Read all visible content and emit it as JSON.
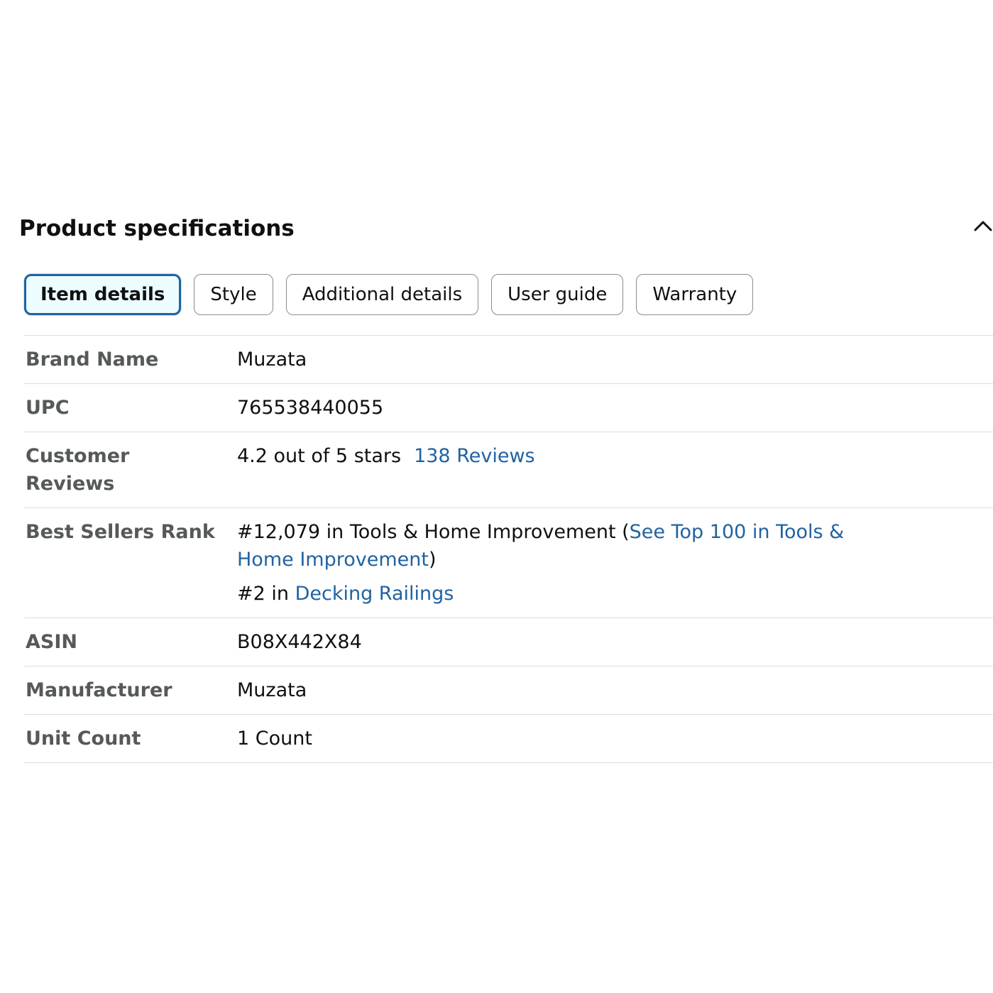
{
  "section": {
    "title": "Product specifications"
  },
  "tabs": [
    {
      "label": "Item details",
      "active": true
    },
    {
      "label": "Style",
      "active": false
    },
    {
      "label": "Additional details",
      "active": false
    },
    {
      "label": "User guide",
      "active": false
    },
    {
      "label": "Warranty",
      "active": false
    }
  ],
  "details": {
    "brand_name": {
      "label": "Brand Name",
      "value": "Muzata"
    },
    "upc": {
      "label": "UPC",
      "value": "765538440055"
    },
    "customer_reviews": {
      "label": "Customer Reviews",
      "rating_text": "4.2 out of 5 stars",
      "reviews_count": "138",
      "reviews_word": "Reviews"
    },
    "best_sellers_rank": {
      "label": "Best Sellers Rank",
      "rank1_prefix": "#12,079 in Tools & Home Improvement (",
      "rank1_link": "See Top 100 in Tools & Home Improvement",
      "rank1_suffix": ")",
      "rank2_prefix": "#2 in ",
      "rank2_link": "Decking Railings"
    },
    "asin": {
      "label": "ASIN",
      "value": "B08X442X84"
    },
    "manufacturer": {
      "label": "Manufacturer",
      "value": "Muzata"
    },
    "unit_count": {
      "label": "Unit Count",
      "value": "1 Count"
    }
  },
  "icons": {
    "collapse": "chevron-up-icon"
  },
  "colors": {
    "link": "#2162a1",
    "active_tab_border": "#2162a1",
    "active_tab_bg": "#edfdff",
    "label_text": "#565959",
    "divider": "#dddddd"
  }
}
